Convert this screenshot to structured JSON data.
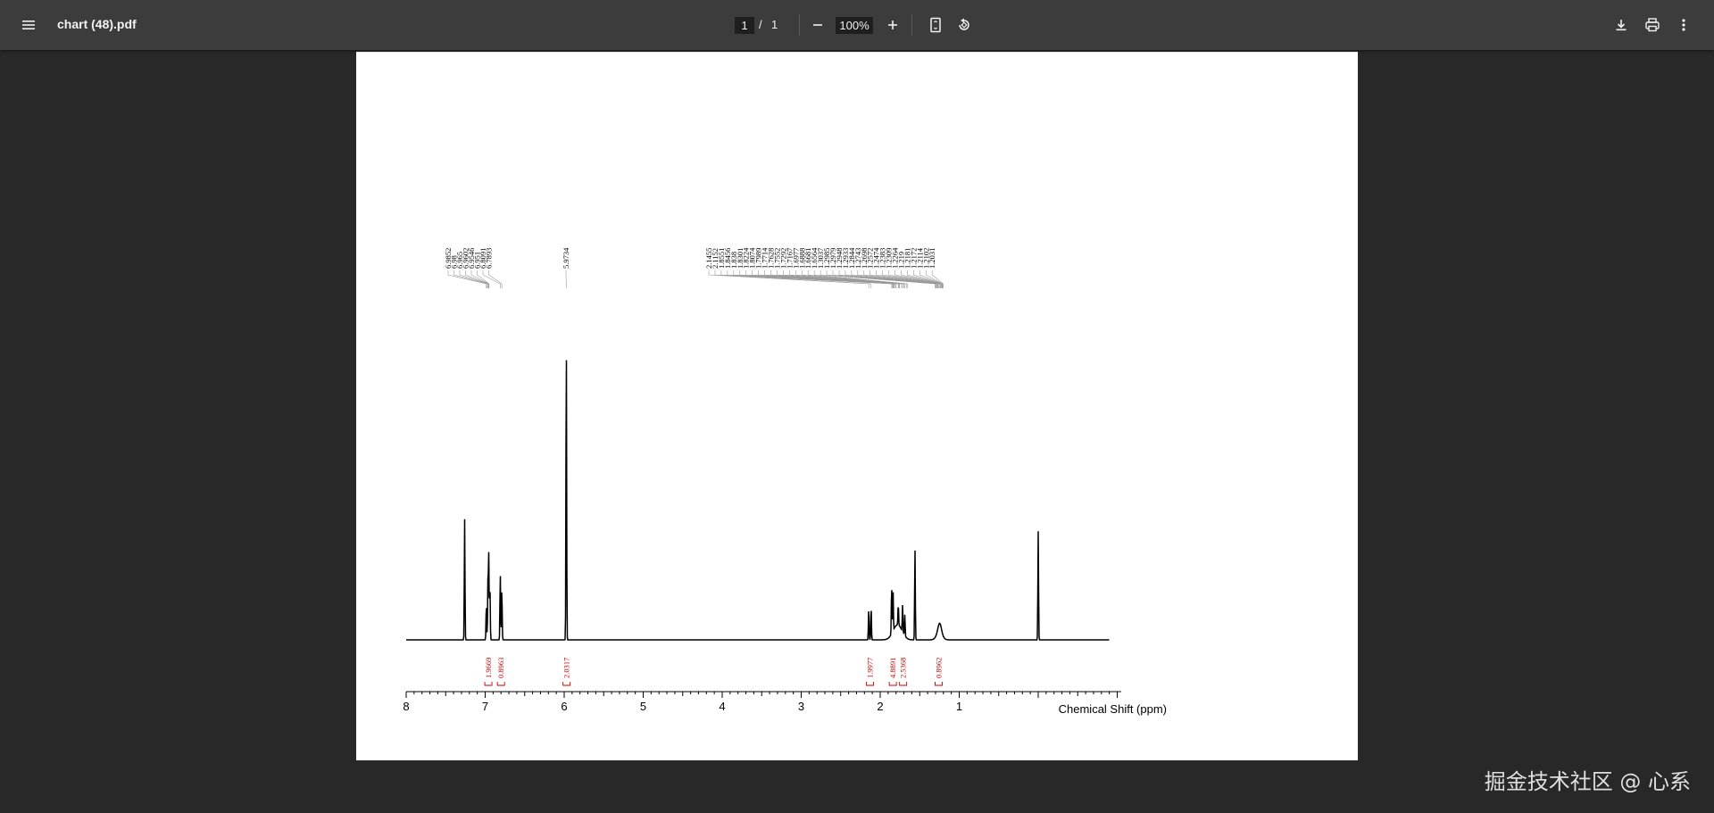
{
  "toolbar": {
    "title": "chart (48).pdf",
    "page_current": "1",
    "page_separator": "/",
    "page_total": "1",
    "zoom": "100%",
    "icons": [
      "menu-icon",
      "zoom-out-icon",
      "zoom-in-icon",
      "fit-page-icon",
      "rotate-icon",
      "download-icon",
      "print-icon",
      "more-vert-icon"
    ]
  },
  "watermark": "掘金技术社区 @ 心系",
  "chart_data": {
    "type": "line",
    "title": "",
    "xlabel": "Chemical Shift (ppm)",
    "ylabel": "",
    "xlim": [
      8,
      -0.9
    ],
    "x_reversed": true,
    "xticks": [
      8,
      7,
      6,
      5,
      4,
      3,
      2,
      1
    ],
    "line_color": "#000000",
    "integral_color": "#cc0000",
    "peaks": [
      {
        "x": 7.26,
        "height": 0.4
      },
      {
        "x": 6.9852,
        "height": 0.12
      },
      {
        "x": 6.965,
        "height": 0.2
      },
      {
        "x": 6.9546,
        "height": 0.28
      },
      {
        "x": 6.94,
        "height": 0.18
      },
      {
        "x": 6.8091,
        "height": 0.22
      },
      {
        "x": 6.7893,
        "height": 0.17
      },
      {
        "x": 5.9734,
        "height": 1.0
      },
      {
        "x": 2.1455,
        "height": 0.1
      },
      {
        "x": 2.1152,
        "height": 0.11
      },
      {
        "x": 1.8551,
        "height": 0.16
      },
      {
        "x": 1.838,
        "height": 0.14
      },
      {
        "x": 1.7714,
        "height": 0.07
      },
      {
        "x": 1.7167,
        "height": 0.09
      },
      {
        "x": 1.6888,
        "height": 0.07
      },
      {
        "x": 1.56,
        "height": 0.3
      },
      {
        "x": 1.2474,
        "height": 0.03
      },
      {
        "x": 0.0,
        "height": 0.36
      }
    ],
    "shift_labels_group1": [
      "6.9852",
      "6.98",
      "6.965",
      "6.9602",
      "6.9546",
      "6.951",
      "6.8091",
      "6.7893"
    ],
    "shift_labels_group2": [
      "5.9734"
    ],
    "shift_labels_group3": [
      "2.1455",
      "2.1152",
      "1.8551",
      "1.8456",
      "1.838",
      "1.8301",
      "1.8224",
      "1.8074",
      "1.7989",
      "1.7714",
      "1.7628",
      "1.7552",
      "1.7292",
      "1.7167",
      "1.6977",
      "1.6888",
      "1.6681",
      "1.6564",
      "1.3037",
      "1.2985",
      "1.2979",
      "1.2948",
      "1.2933",
      "1.2844",
      "1.2743",
      "1.2698",
      "1.2572",
      "1.2474",
      "1.2383",
      "1.2309",
      "1.2264",
      "1.219",
      "1.2181",
      "1.2172",
      "1.2114",
      "1.2102",
      "1.2031"
    ],
    "integrals": [
      {
        "x": 6.96,
        "value": "1.9669"
      },
      {
        "x": 6.8,
        "value": "0.8963"
      },
      {
        "x": 5.97,
        "value": "2.0317"
      },
      {
        "x": 2.13,
        "value": "1.9977"
      },
      {
        "x": 1.84,
        "value": "4.8891"
      },
      {
        "x": 1.71,
        "value": "2.5368"
      },
      {
        "x": 1.26,
        "value": "0.8962"
      }
    ]
  }
}
